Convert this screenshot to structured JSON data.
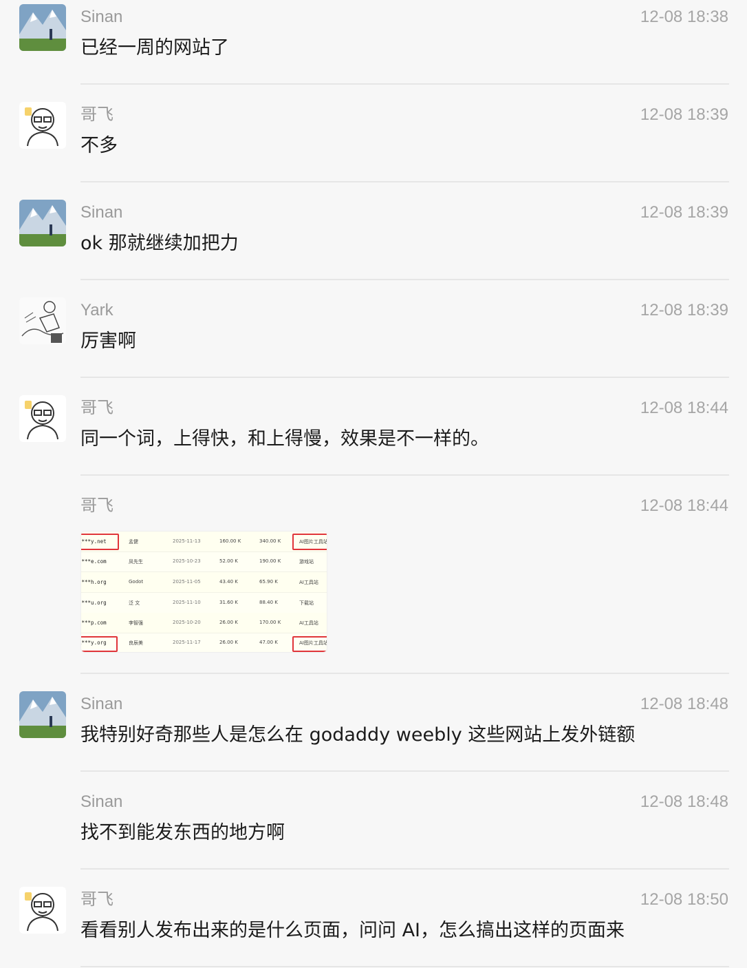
{
  "messages": [
    {
      "sender": "Sinan",
      "time": "12-08 18:38",
      "text": "已经一周的网站了",
      "avatar": "mountain-avatar"
    },
    {
      "sender": "哥飞",
      "time": "12-08 18:39",
      "text": "不多",
      "avatar": "cartoon-man-avatar"
    },
    {
      "sender": "Sinan",
      "time": "12-08 18:39",
      "text": "ok 那就继续加把力",
      "avatar": "mountain-avatar"
    },
    {
      "sender": "Yark",
      "time": "12-08 18:39",
      "text": "厉害啊",
      "avatar": "sketch-avatar"
    },
    {
      "sender": "哥飞",
      "time": "12-08 18:44",
      "text": "同一个词，上得快，和上得慢，效果是不一样的。",
      "avatar": "cartoon-man-avatar"
    },
    {
      "sender": "哥飞",
      "time": "12-08 18:44",
      "text": "",
      "avatar": ""
    },
    {
      "sender": "Sinan",
      "time": "12-08 18:48",
      "text": "我特别好奇那些人是怎么在 godaddy weebly 这些网站上发外链额",
      "avatar": "mountain-avatar"
    },
    {
      "sender": "Sinan",
      "time": "12-08 18:48",
      "text": "找不到能发东西的地方啊",
      "avatar": ""
    },
    {
      "sender": "哥飞",
      "time": "12-08 18:50",
      "text": "看看别人发布出来的是什么页面，问问 AI，怎么搞出这样的页面来",
      "avatar": "cartoon-man-avatar"
    }
  ],
  "screenshot_table": {
    "rows": [
      [
        "k***y.net",
        "孟健",
        "2025-11-13",
        "160.00 K",
        "340.00 K",
        "AI图片工具站"
      ],
      [
        "s***e.com",
        "凤先生",
        "2025-10-23",
        "52.00 K",
        "190.00 K",
        "游戏站"
      ],
      [
        "t***h.org",
        "Godot",
        "2025-11-05",
        "43.40 K",
        "65.90 K",
        "AI工具站"
      ],
      [
        "p***u.org",
        "泛 文",
        "2025-11-10",
        "31.60 K",
        "88.40 K",
        "下载站"
      ],
      [
        "s***p.com",
        "李智强",
        "2025-10-20",
        "26.00 K",
        "170.00 K",
        "AI工具站"
      ],
      [
        "k***y.org",
        "良辰美",
        "2025-11-17",
        "26.00 K",
        "47.00 K",
        "AI图片工具站"
      ]
    ]
  },
  "colors": {
    "background": "#f7f7f7",
    "meta_text": "#9a9a9a",
    "message_text": "#1b1b1b",
    "highlight_box": "#e0343a"
  }
}
